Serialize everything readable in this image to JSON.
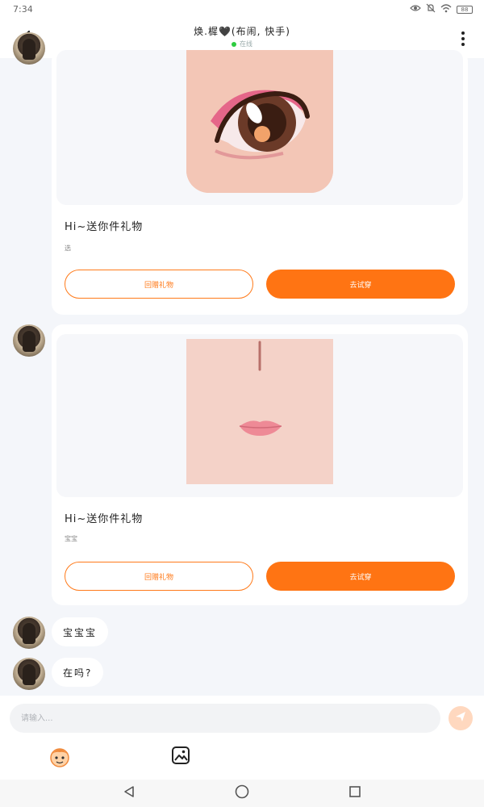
{
  "status_bar": {
    "time": "7:34",
    "battery": "88"
  },
  "header": {
    "title": "焕.樨🖤(布闹, 快手)",
    "status": "在线"
  },
  "messages": [
    {
      "gift_title": "Hi~送你件礼物",
      "gift_sub": "选",
      "btn_return": "回赠礼物",
      "btn_try": "去试穿"
    },
    {
      "gift_title": "Hi~送你件礼物",
      "gift_sub": "宝宝",
      "btn_return": "回赠礼物",
      "btn_try": "去试穿"
    }
  ],
  "texts": [
    "宝宝宝",
    "在吗?"
  ],
  "input": {
    "placeholder": "请输入..."
  },
  "colors": {
    "accent": "#ff7413",
    "online": "#2ecc40",
    "background": "#f4f6fa"
  },
  "icons": {
    "back": "chevron-left-icon",
    "more": "more-vertical-icon",
    "send": "send-icon",
    "emoji": "emoji-face-icon",
    "image": "image-icon"
  }
}
